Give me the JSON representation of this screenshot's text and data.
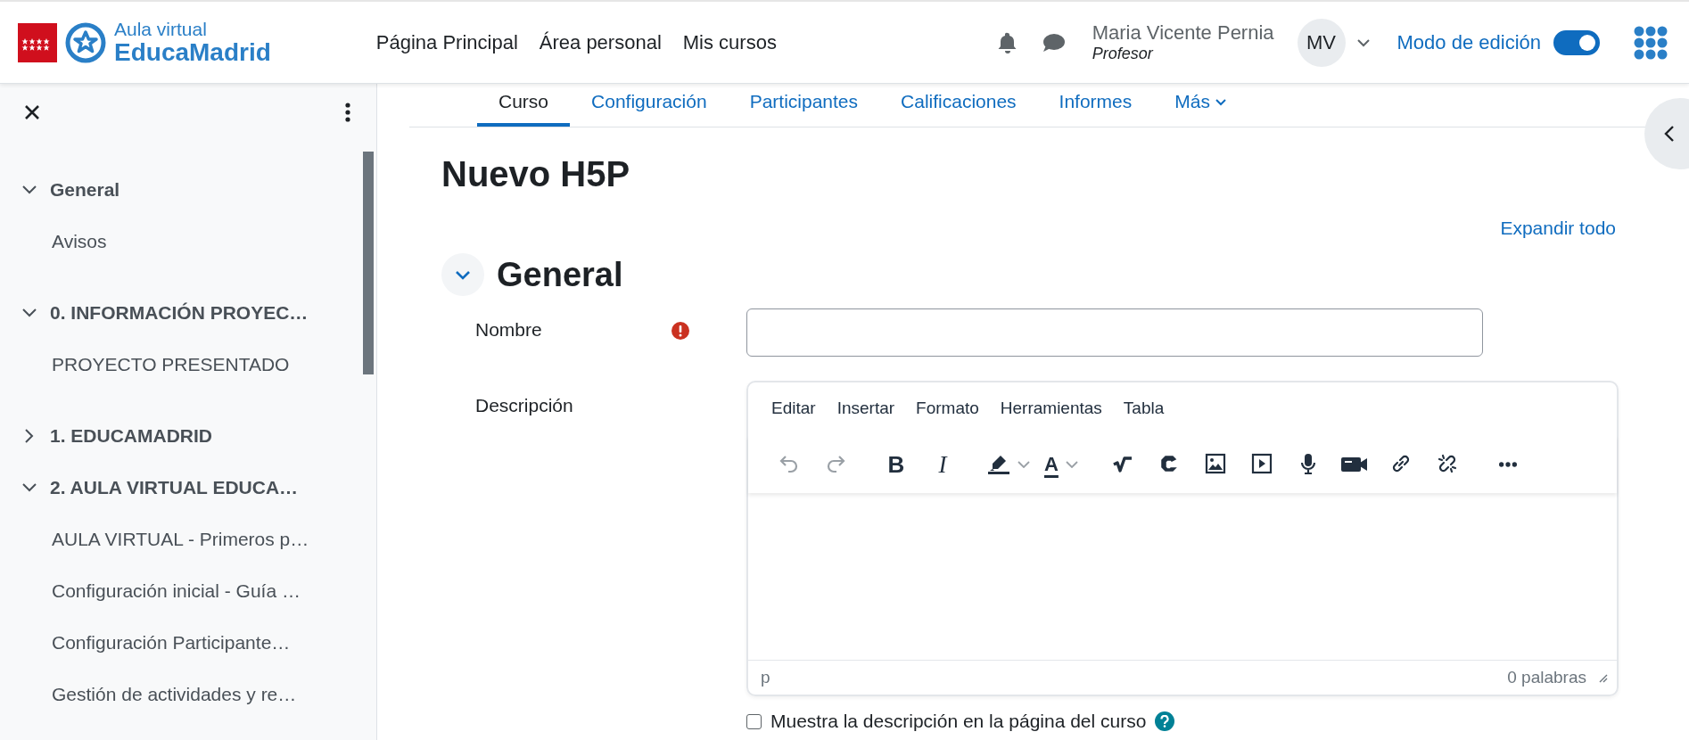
{
  "header": {
    "logo": {
      "line1": "Aula virtual",
      "line2": "EducaMadrid"
    },
    "nav": [
      {
        "label": "Página Principal"
      },
      {
        "label": "Área personal"
      },
      {
        "label": "Mis cursos"
      }
    ],
    "user": {
      "name": "Maria Vicente Pernia",
      "role": "Profesor",
      "initials": "MV"
    },
    "edit_mode": {
      "label": "Modo de edición",
      "on": true
    }
  },
  "sidebar": {
    "items": [
      {
        "label": "General",
        "expanded": true,
        "children": [
          {
            "label": "Avisos"
          }
        ]
      },
      {
        "label": "0. INFORMACIÓN PROYEC…",
        "expanded": true,
        "children": [
          {
            "label": "PROYECTO PRESENTADO"
          }
        ]
      },
      {
        "label": "1. EDUCAMADRID",
        "expanded": false
      },
      {
        "label": "2. AULA VIRTUAL EDUCA…",
        "expanded": true,
        "children": [
          {
            "label": "AULA VIRTUAL - Primeros p…"
          },
          {
            "label": "Configuración inicial - Guía …"
          },
          {
            "label": "Configuración Participante…"
          },
          {
            "label": "Gestión de actividades y re…"
          }
        ]
      }
    ]
  },
  "tabs": [
    {
      "label": "Curso",
      "selected": true
    },
    {
      "label": "Configuración",
      "selected": false
    },
    {
      "label": "Participantes",
      "selected": false
    },
    {
      "label": "Calificaciones",
      "selected": false
    },
    {
      "label": "Informes",
      "selected": false
    },
    {
      "label": "Más",
      "selected": false
    }
  ],
  "page_title": "Nuevo H5P",
  "expand_all": "Expandir todo",
  "section": {
    "title": "General",
    "expanded": true
  },
  "fields": [
    {
      "kind": "text",
      "label": "Nombre",
      "required": true
    },
    {
      "kind": "editor",
      "label": "Descripción",
      "required": false,
      "menu": [
        "Editar",
        "Insertar",
        "Formato",
        "Herramientas",
        "Tabla"
      ],
      "toolbar": [
        {
          "kind": "undo",
          "disabled": true
        },
        {
          "kind": "redo",
          "disabled": true
        },
        {
          "kind": "bold",
          "glyph": "B",
          "disabled": false
        },
        {
          "kind": "italic",
          "glyph": "I",
          "disabled": false
        },
        {
          "kind": "highlight",
          "disabled": false
        },
        {
          "kind": "textcolor",
          "glyph": "A",
          "disabled": false
        },
        {
          "kind": "equation",
          "disabled": false
        },
        {
          "kind": "h5p",
          "disabled": false
        },
        {
          "kind": "image",
          "disabled": false
        },
        {
          "kind": "media",
          "disabled": false
        },
        {
          "kind": "audio",
          "disabled": false
        },
        {
          "kind": "video",
          "disabled": false
        },
        {
          "kind": "link",
          "disabled": false
        },
        {
          "kind": "unlink",
          "disabled": false
        },
        {
          "kind": "more",
          "disabled": false
        }
      ],
      "path": "p",
      "word_count": "0 palabras"
    }
  ],
  "checkbox": {
    "label": "Muestra la descripción en la página del curso",
    "checked": false
  }
}
